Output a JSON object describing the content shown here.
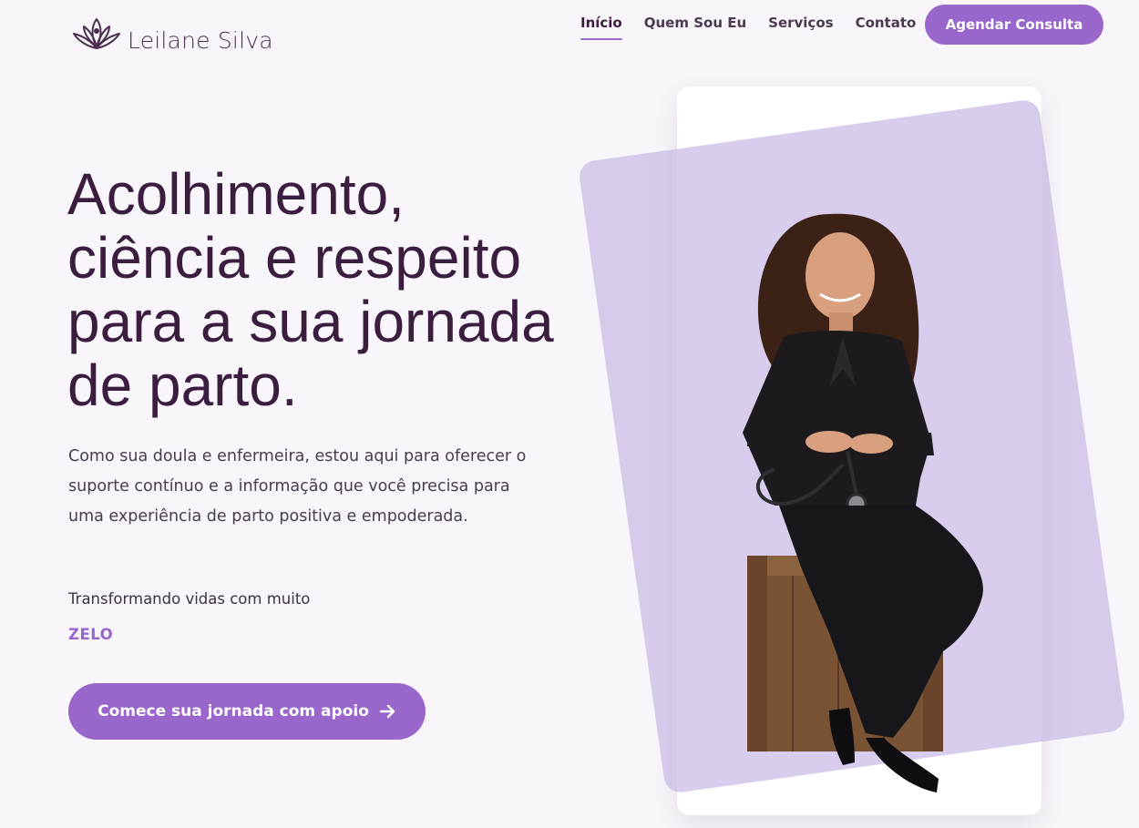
{
  "brand": {
    "name": "Leilane Silva",
    "logo_icon": "lotus-icon"
  },
  "nav": {
    "items": [
      {
        "label": "Início",
        "active": true
      },
      {
        "label": "Quem Sou Eu",
        "active": false
      },
      {
        "label": "Serviços",
        "active": false
      },
      {
        "label": "Contato",
        "active": false
      }
    ],
    "cta_label": "Agendar Consulta"
  },
  "hero": {
    "title_lines": [
      "Acolhimento,",
      "ciência e respeito",
      "para a sua jornada",
      "de parto."
    ],
    "description": "Como sua doula e enfermeira, estou aqui para oferecer o suporte contínuo e a informação que você precisa para uma experiência de parto positiva e empoderada.",
    "tagline": "Transformando vidas com muito",
    "tag_word": "ZELO",
    "cta_label": "Comece sua jornada com apoio",
    "cta_icon": "arrow-right-icon"
  },
  "colors": {
    "accent": "#9966cc",
    "heading": "#3a1d3f",
    "background": "#f8f6fa",
    "photo_backdrop": "#d6cbea"
  }
}
